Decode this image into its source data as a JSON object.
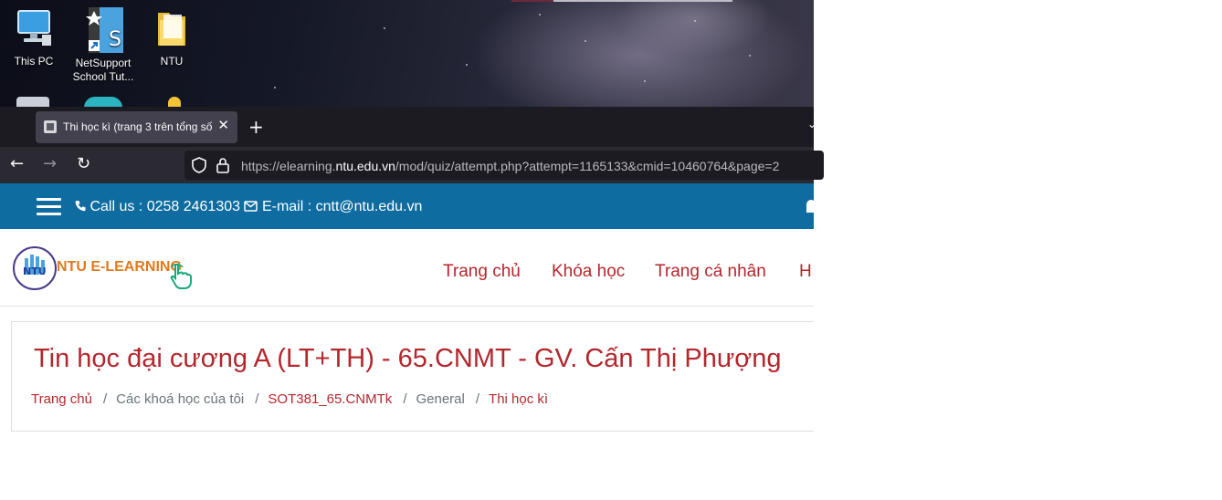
{
  "desktop": {
    "icons": [
      {
        "label": "This PC",
        "icon": "computer-icon"
      },
      {
        "label": "NetSupport School Tut...",
        "icon": "netsupport-icon"
      },
      {
        "label": "NTU",
        "icon": "folder-icon"
      }
    ]
  },
  "browser": {
    "tab": {
      "title": "Thi học kì (trang 3 trên tổng số",
      "close": "✕"
    },
    "new_tab": "+",
    "overflow": "⌄",
    "nav": {
      "back": "←",
      "forward": "→",
      "reload": "↻"
    },
    "url": {
      "scheme": "https://",
      "subdomain": "elearning.",
      "host": "ntu.edu.vn",
      "path": "/mod/quiz/attempt.php?attempt=1165133&cmid=10460764&page=2"
    }
  },
  "site": {
    "infobar": {
      "call_label": "Call us : 0258 2461303",
      "email_label": "E-mail : cntt@ntu.edu.vn"
    },
    "logo_text": "NTU E-LEARNING",
    "logo_badge": "NTU",
    "menu": [
      "Trang chủ",
      "Khóa học",
      "Trang cá nhân",
      "H"
    ],
    "course_title": "Tin học đại cương A (LT+TH) - 65.CNMT - GV. Cấn Thị Phượng",
    "breadcrumb": [
      {
        "label": "Trang chủ",
        "link": true
      },
      {
        "label": "Các khoá học của tôi",
        "link": false
      },
      {
        "label": "SOT381_65.CNMTk",
        "link": true
      },
      {
        "label": "General",
        "link": false
      },
      {
        "label": "Thi học kì",
        "link": true
      }
    ]
  },
  "colors": {
    "brand_blue": "#0e6ca0",
    "brand_red": "#b3272d",
    "logo_orange": "#e07a1f"
  }
}
